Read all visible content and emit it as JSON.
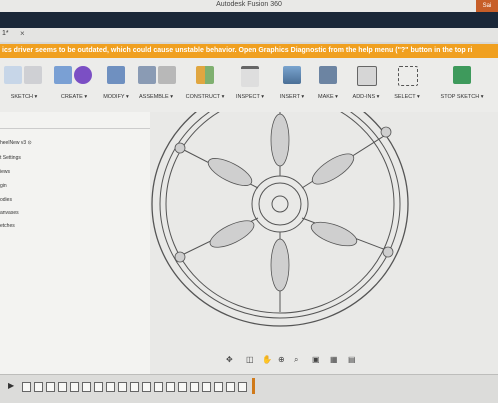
{
  "window": {
    "title": "Autodesk Fusion 360",
    "user_badge": "Sai"
  },
  "tabs": [
    {
      "label": "1*",
      "close": "×"
    }
  ],
  "warning_text": "ics driver seems to be outdated, which could cause unstable behavior. Open Graphics Diagnostic from the help menu (\"?\" button in the top ri",
  "toolbar": {
    "groups": [
      {
        "label": "SKETCH ▾"
      },
      {
        "label": "CREATE ▾"
      },
      {
        "label": "MODIFY ▾"
      },
      {
        "label": "ASSEMBLE ▾"
      },
      {
        "label": "CONSTRUCT ▾"
      },
      {
        "label": "INSPECT ▾"
      },
      {
        "label": "INSERT ▾"
      },
      {
        "label": "MAKE ▾"
      },
      {
        "label": "ADD-INS ▾"
      },
      {
        "label": "SELECT ▾"
      },
      {
        "label": "STOP SKETCH ▾"
      }
    ]
  },
  "browser": {
    "root": "heelNew v3",
    "items": [
      "t Settings",
      "iews",
      "gin",
      "odies",
      "anvases",
      "etches"
    ]
  },
  "colors": {
    "accent": "#f0a020",
    "titlebar_dark": "#1a2738",
    "stop_sketch": "#3e9a5c"
  },
  "icons": [
    "search-icon",
    "gear-icon"
  ]
}
